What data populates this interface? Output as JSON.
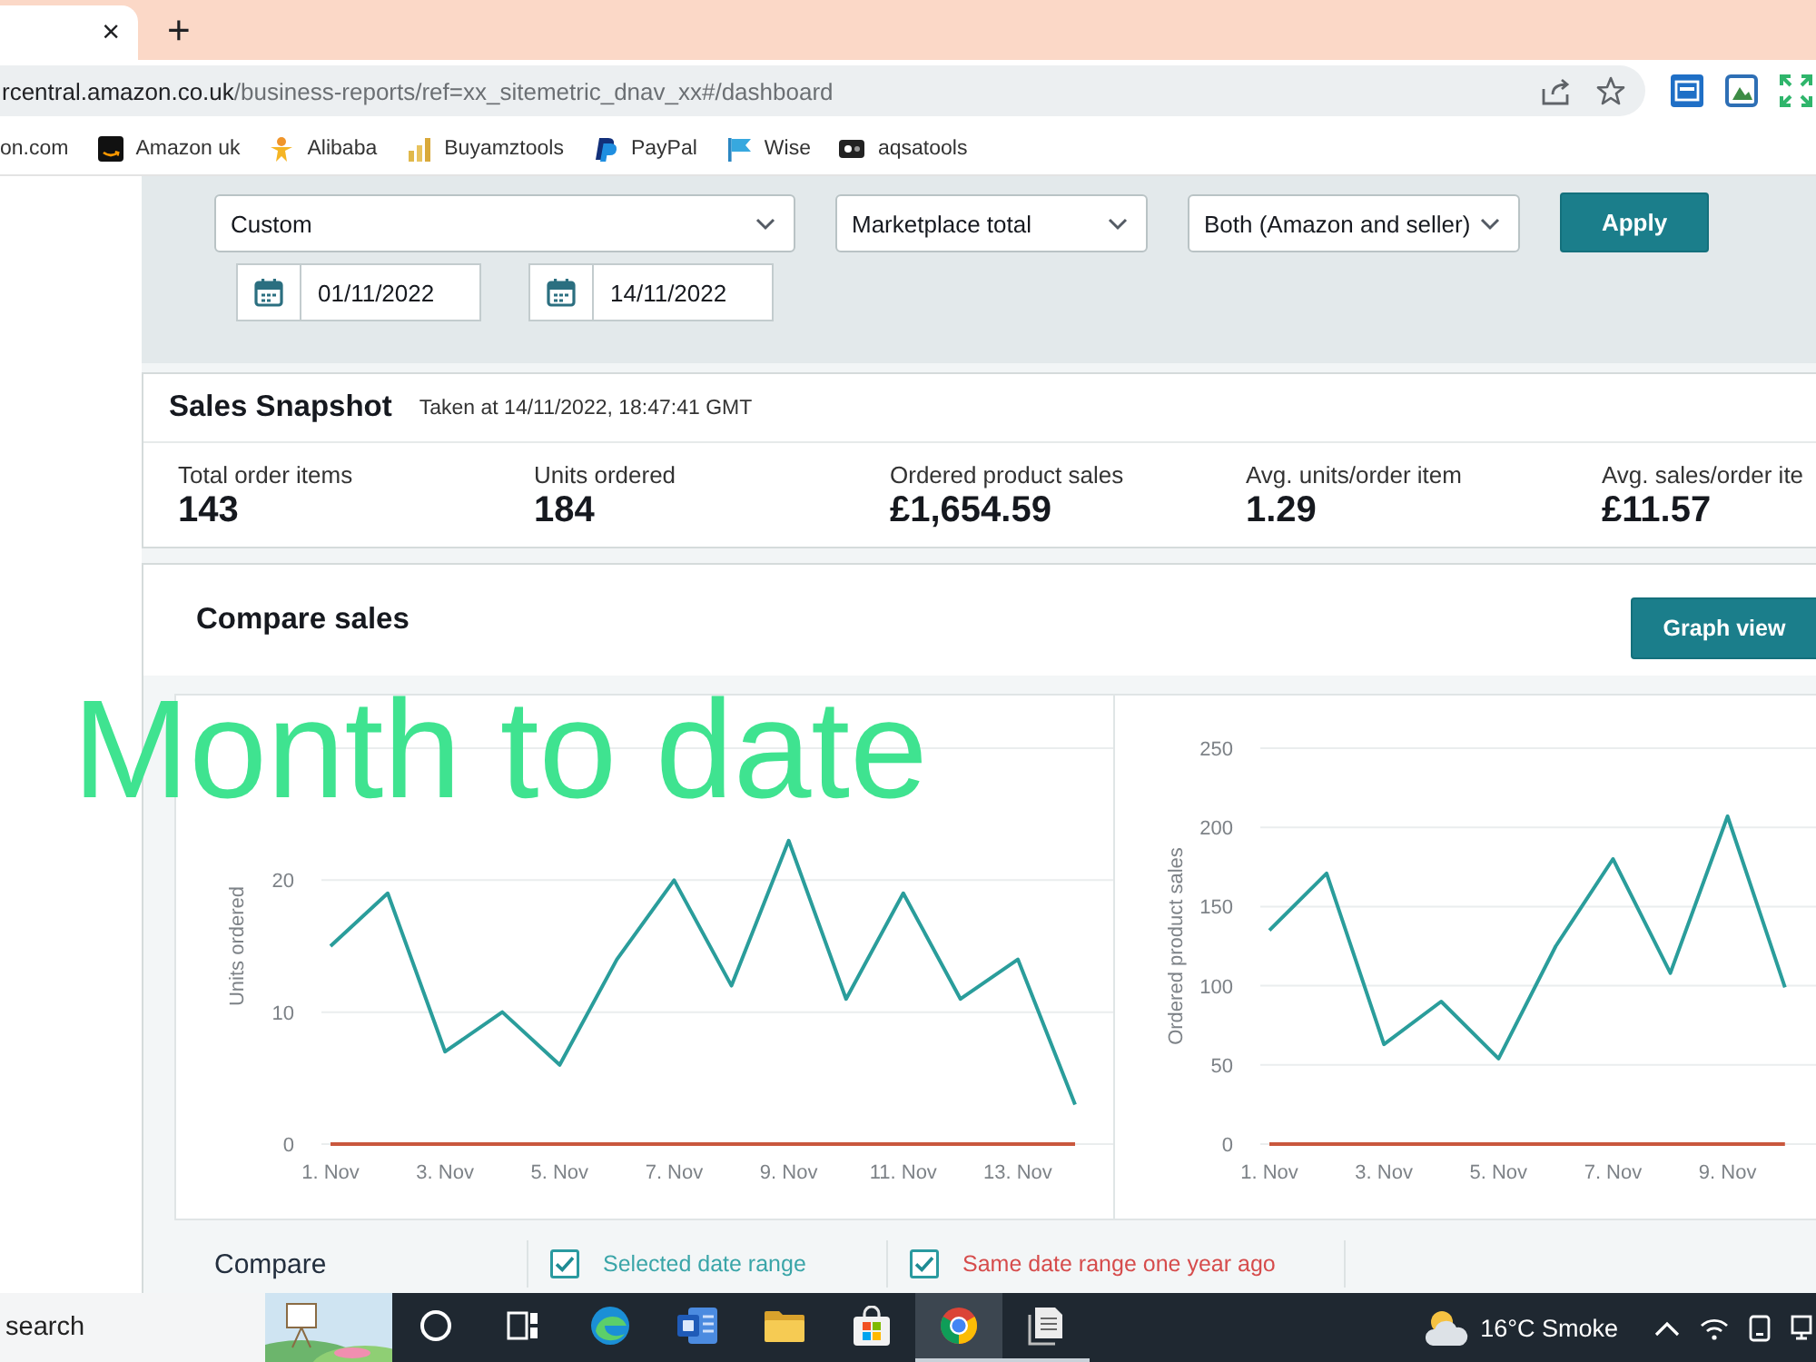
{
  "browser": {
    "tabs": [
      {
        "close": "×",
        "selected": true
      }
    ],
    "new_tab": "+",
    "url_host": "rcentral.amazon.co.uk",
    "url_path": "/business-reports/ref=xx_sitemetric_dnav_xx#/dashboard"
  },
  "bookmarks": [
    {
      "label": "on.com",
      "kind": "none"
    },
    {
      "label": "Amazon uk",
      "kind": "tile"
    },
    {
      "label": "Alibaba",
      "kind": "figure"
    },
    {
      "label": "Buyamztools",
      "kind": "bars"
    },
    {
      "label": "PayPal",
      "kind": "p-mark"
    },
    {
      "label": "Wise",
      "kind": "flag"
    },
    {
      "label": "aqsatools",
      "kind": "badge"
    }
  ],
  "filters": {
    "selects": [
      {
        "value": "Custom"
      },
      {
        "value": "Marketplace total"
      },
      {
        "value": "Both (Amazon and seller)"
      }
    ],
    "apply": "Apply",
    "dates": [
      {
        "value": "01/11/2022"
      },
      {
        "value": "14/11/2022"
      }
    ]
  },
  "snapshot": {
    "title": "Sales Snapshot",
    "taken": "Taken at 14/11/2022, 18:47:41 GMT",
    "metrics": [
      {
        "label": "Total order items",
        "value": "143"
      },
      {
        "label": "Units ordered",
        "value": "184"
      },
      {
        "label": "Ordered product sales",
        "value": "£1,654.59"
      },
      {
        "label": "Avg. units/order item",
        "value": "1.29"
      },
      {
        "label": "Avg. sales/order ite",
        "value": "£11.57"
      }
    ]
  },
  "compare": {
    "title": "Compare sales",
    "view_button": "Graph view",
    "charts": [
      {
        "chart_data": {
          "type": "line",
          "grid": true,
          "ylabel": "Units ordered",
          "categories": [
            "1. Nov",
            null,
            "3. Nov",
            null,
            "5. Nov",
            null,
            "7. Nov",
            null,
            "9. Nov",
            null,
            "11. Nov",
            null,
            "13. Nov",
            null
          ],
          "ylim": [
            0,
            30
          ],
          "yticks": [
            0,
            10,
            20
          ],
          "series": [
            {
              "color": "#2a9d9b",
              "values": [
                15,
                19,
                7,
                10,
                6,
                14,
                20,
                12,
                23,
                11,
                19,
                11,
                14,
                3
              ]
            },
            {
              "color": "#c9573d",
              "values": [
                0,
                0,
                0,
                0,
                0,
                0,
                0,
                0,
                0,
                0,
                0,
                0,
                0,
                0
              ]
            }
          ]
        }
      },
      {
        "chart_data": {
          "type": "line",
          "grid": true,
          "ylabel": "Ordered product sales",
          "categories": [
            "1. Nov",
            null,
            "3. Nov",
            null,
            "5. Nov",
            null,
            "7. Nov",
            null,
            "9. Nov",
            null
          ],
          "ylim": [
            0,
            250
          ],
          "yticks": [
            0,
            50,
            100,
            150,
            200,
            250
          ],
          "series": [
            {
              "color": "#2a9d9b",
              "values": [
                135,
                171,
                63,
                90,
                54,
                125,
                180,
                108,
                207,
                99
              ]
            },
            {
              "color": "#c9573d",
              "values": [
                0,
                0,
                0,
                0,
                0,
                0,
                0,
                0,
                0,
                0
              ]
            }
          ]
        }
      }
    ],
    "legend_title": "Compare",
    "legend": [
      {
        "label": "Selected date range",
        "checked": true,
        "color": "#3aa5a8"
      },
      {
        "label": "Same date range one year ago",
        "checked": true,
        "color": "#d64c4c"
      }
    ]
  },
  "annotation": {
    "text": "Month to date"
  },
  "taskbar": {
    "search": {
      "placeholder": "search"
    },
    "apps": [
      {
        "kind": "ring",
        "selected": false,
        "running": false
      },
      {
        "kind": "task-view",
        "selected": false,
        "running": false
      },
      {
        "kind": "swirl",
        "selected": false,
        "running": false
      },
      {
        "kind": "doc-tile",
        "selected": false,
        "running": false
      },
      {
        "kind": "folder",
        "selected": false,
        "running": false
      },
      {
        "kind": "bag",
        "selected": false,
        "running": false
      },
      {
        "kind": "wheel",
        "selected": true,
        "running": true
      },
      {
        "kind": "papers",
        "selected": false,
        "running": true
      }
    ],
    "weather": "16°C Smoke"
  }
}
